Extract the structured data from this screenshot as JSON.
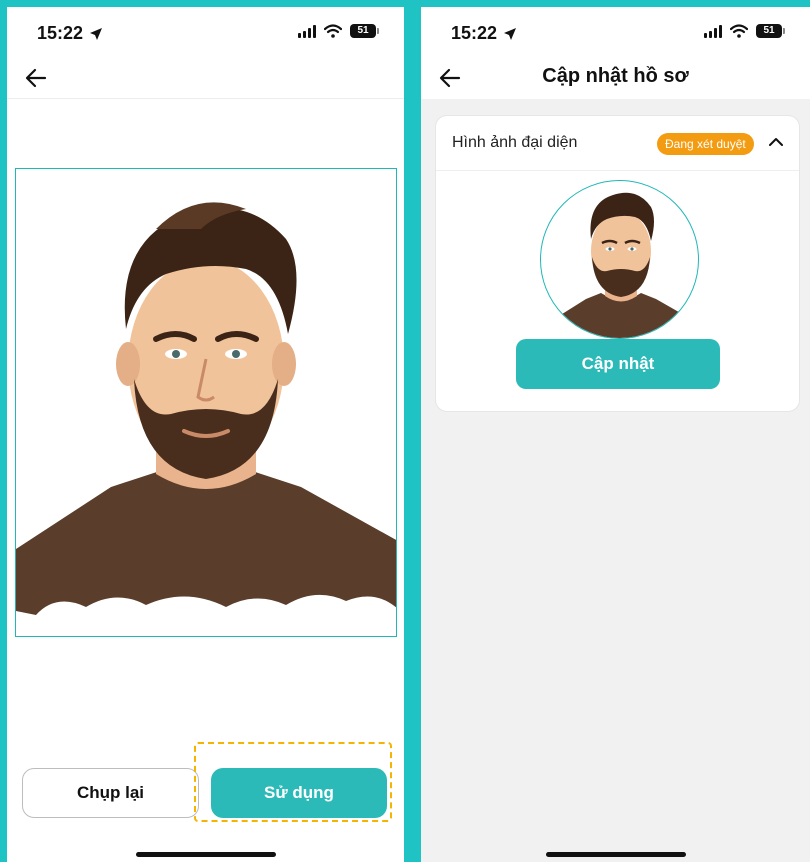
{
  "left_screen": {
    "status": {
      "time": "15:22",
      "battery": "51"
    },
    "buttons": {
      "retake": "Chụp lại",
      "use": "Sử dụng"
    }
  },
  "right_screen": {
    "status": {
      "time": "15:22",
      "battery": "51"
    },
    "header": {
      "title": "Cập nhật hồ sơ"
    },
    "card": {
      "title": "Hình ảnh đại diện",
      "badge": "Đang xét duyệt",
      "update_button": "Cập nhật"
    }
  },
  "colors": {
    "accent": "#2bbab8",
    "frame_bg": "#1fc3c3",
    "badge": "#f39c12",
    "highlight": "#f4b400"
  },
  "icons": [
    "location-arrow-icon",
    "signal-icon",
    "wifi-icon",
    "battery-icon",
    "back-arrow-icon",
    "chevron-up-icon"
  ]
}
